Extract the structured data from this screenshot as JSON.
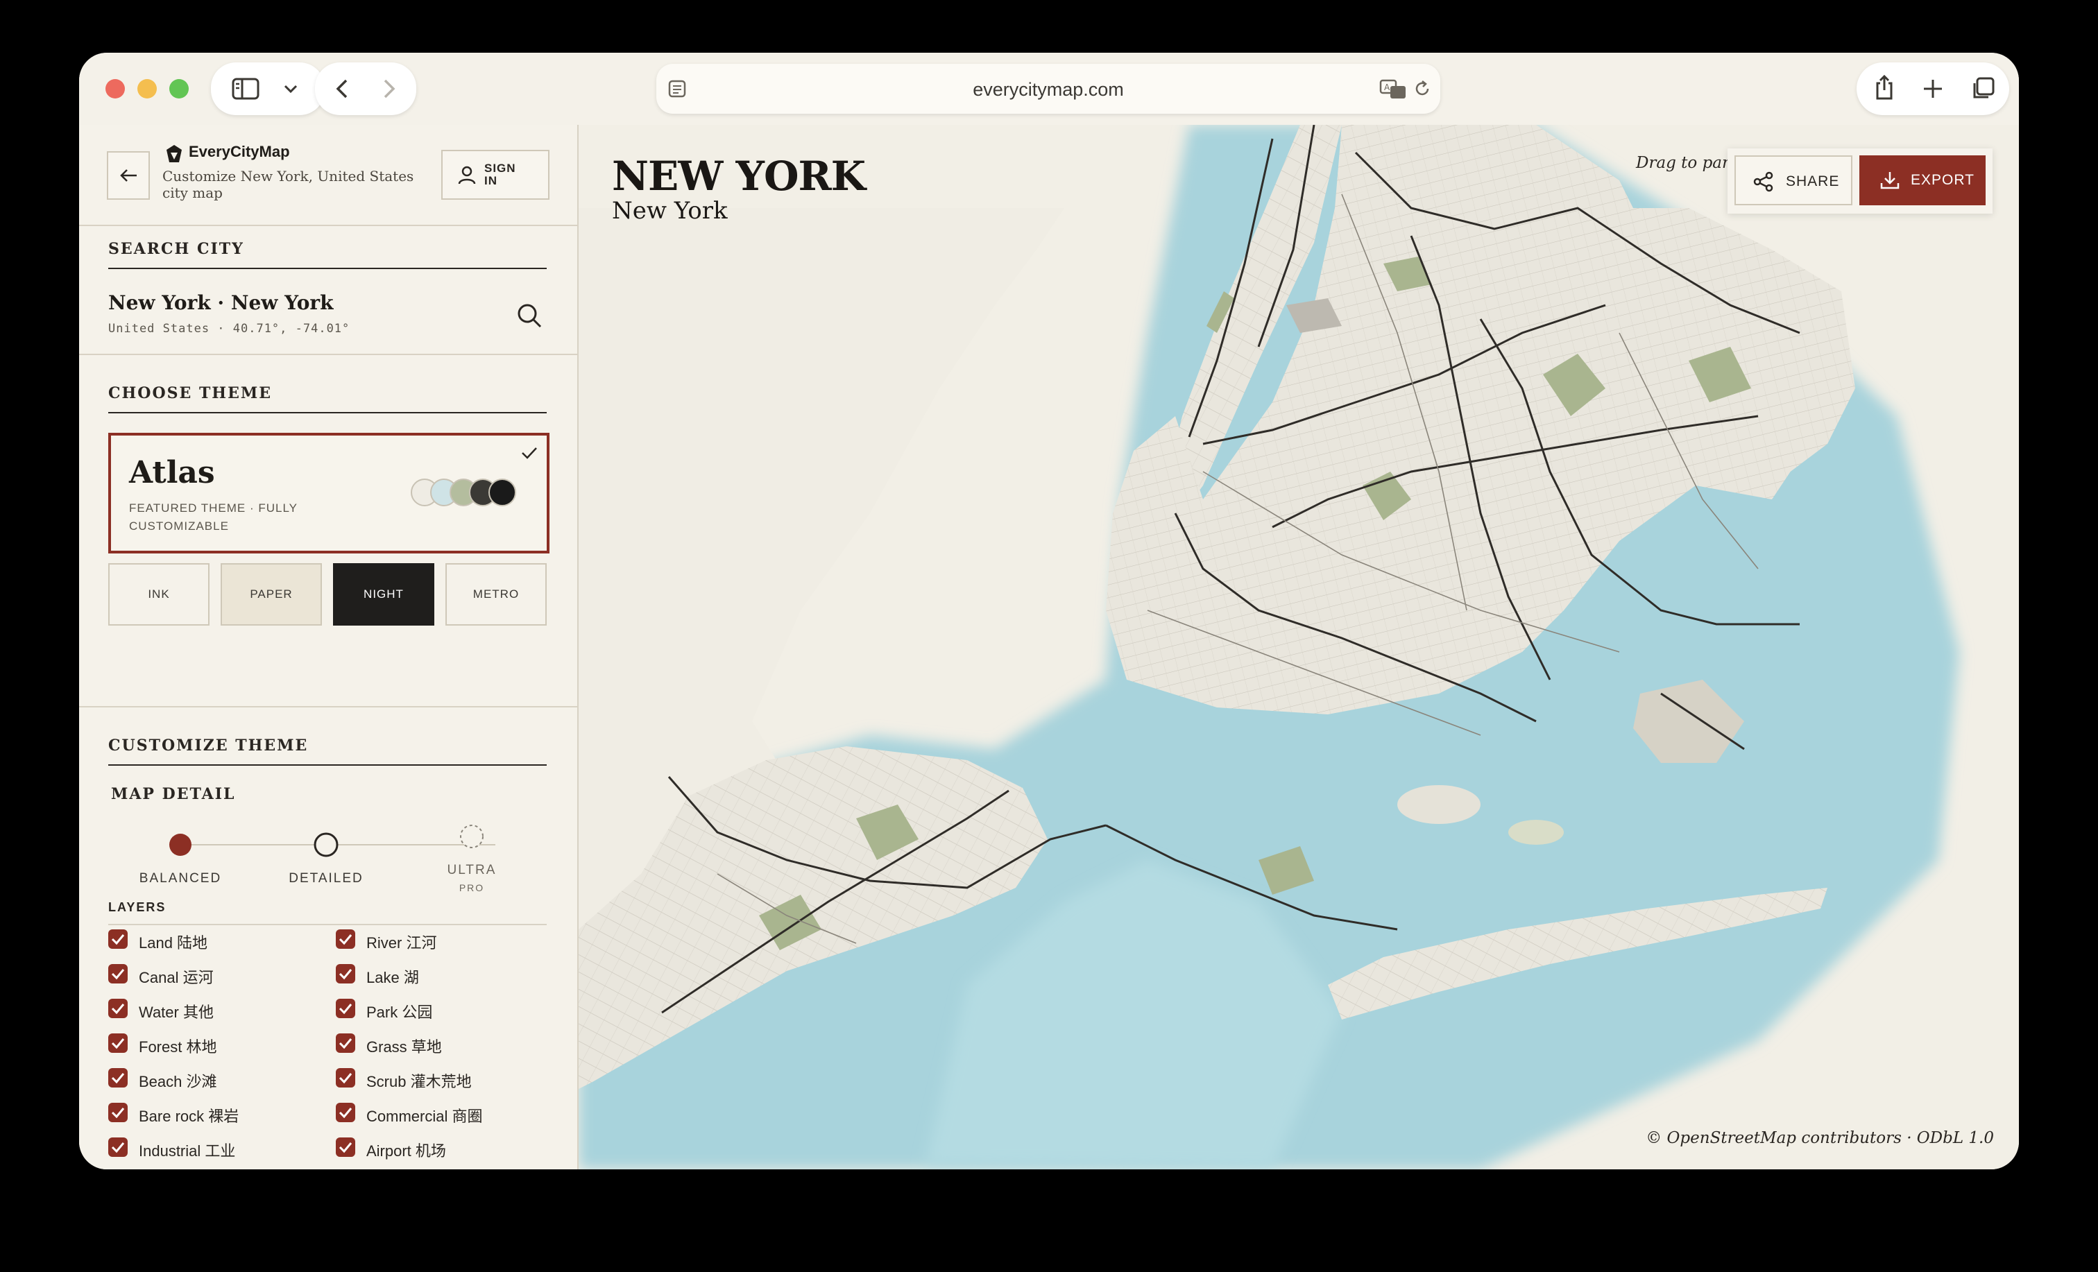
{
  "browser": {
    "url": "everycitymap.com"
  },
  "app": {
    "brand": "EveryCityMap",
    "subtitle": "Customize New York, United States city map",
    "sign_in": "SIGN IN"
  },
  "search": {
    "section_title": "SEARCH CITY",
    "city": "New York · New York",
    "details": "United States · 40.71°, -74.01°"
  },
  "theme": {
    "section_title": "CHOOSE THEME",
    "featured": {
      "name": "Atlas",
      "description": "FEATURED THEME · FULLY CUSTOMIZABLE",
      "swatches": [
        "#efece4",
        "#cfe3e6",
        "#b4bd9e",
        "#3b3935",
        "#1a1a1a"
      ]
    },
    "options": [
      {
        "label": "INK",
        "bg": "#f5f2ea",
        "fg": "#3b3833"
      },
      {
        "label": "PAPER",
        "bg": "#ebe5d6",
        "fg": "#3b3833"
      },
      {
        "label": "NIGHT",
        "bg": "#1f1e1c",
        "fg": "#ffffff"
      },
      {
        "label": "METRO",
        "bg": "#f5f2ea",
        "fg": "#3b3833"
      }
    ]
  },
  "customize": {
    "section_title": "CUSTOMIZE THEME",
    "map_detail_title": "MAP DETAIL",
    "levels": [
      {
        "label": "BALANCED",
        "selected": true
      },
      {
        "label": "DETAILED",
        "selected": false
      },
      {
        "label": "ULTRA",
        "badge": "PRO",
        "selected": false
      }
    ]
  },
  "layers": {
    "title": "LAYERS",
    "left": [
      "Land 陆地",
      "Canal 运河",
      "Water 其他",
      "Forest 林地",
      "Beach 沙滩",
      "Bare rock 裸岩",
      "Industrial 工业"
    ],
    "right": [
      "River 江河",
      "Lake 湖",
      "Park 公园",
      "Grass 草地",
      "Scrub 灌木荒地",
      "Commercial 商圈",
      "Airport 机场"
    ]
  },
  "map": {
    "title": "NEW YORK",
    "subtitle": "New York",
    "drag_hint": "Drag to pan ·",
    "share": "SHARE",
    "export": "EXPORT",
    "attribution": "© OpenStreetMap contributors · ODbL 1.0",
    "colors": {
      "water": "#a8d3dc",
      "land": "#e8e5dc",
      "park": "#a9b58f",
      "road": "#2f2c28",
      "accent": "#8c2f24"
    }
  }
}
